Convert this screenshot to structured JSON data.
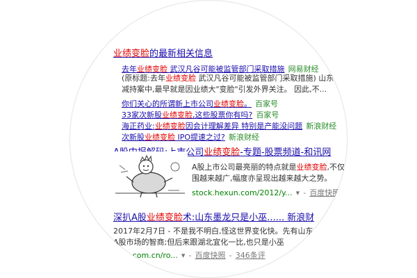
{
  "r1": {
    "title_hl": "业绩变脸",
    "title_rest": "的最新相关信息",
    "news": [
      {
        "pre": "去年",
        "hl": "业绩变脸",
        "post": " 武汉凡谷可能被监管部门采取措施",
        "src": "网易财经"
      },
      {
        "pre": "你们关心的所谓新上市公司",
        "hl": "业绩变脸",
        "post": "。",
        "src": "百家号"
      },
      {
        "pre": "33家次新股",
        "hl": "业绩变脸",
        "post": ",这些股票你有吗?",
        "src": "百家号"
      },
      {
        "pre": "海正药业:",
        "hl": "业绩变脸",
        "post": "因会计理解差异 特别是产能没问题",
        "src": "新浪财经"
      },
      {
        "pre": "次新股",
        "hl": "业绩变脸",
        "post": " IPO提速之过?",
        "src": "新浪财经"
      }
    ],
    "excerpt1_pre": "(原标题:去年",
    "excerpt1_hl": "业绩变脸",
    "excerpt1_post": " 武汉凡谷可能被监管部门采取措施) 山东",
    "excerpt2": "减持案中,最早就是因业绩大\"变脸\"引发外界关注。 因此,不..."
  },
  "r2": {
    "title_pre": "A股中报解码:上市公司",
    "title_hl": "业绩变脸",
    "title_post": "-专题-股票频道-和讯网",
    "s1_pre": "A股上市公司最亮丽的特点就是",
    "s1_hl": "业绩变脸",
    "s1_post": ",不仅",
    "s2": "围越来越广,幅度亦呈现出越来越大之势。",
    "url": "stock.hexun.com/2012/y...",
    "snapshot": "百度快照"
  },
  "r3": {
    "title_pre": "深扒A股",
    "title_hl": "业绩变脸",
    "title_post": "术:山东墨龙只是小巫...... 新浪财",
    "s1": "2017年2月7日 - 不是我不明白,怪这世界变化快。先有山东",
    "s2": "A股市场的智商;但后来跟湖北宜化一比,也只是小巫",
    "url": "...na.com.cn/ro...",
    "snapshot": "百度快照",
    "comments": "346条评"
  }
}
